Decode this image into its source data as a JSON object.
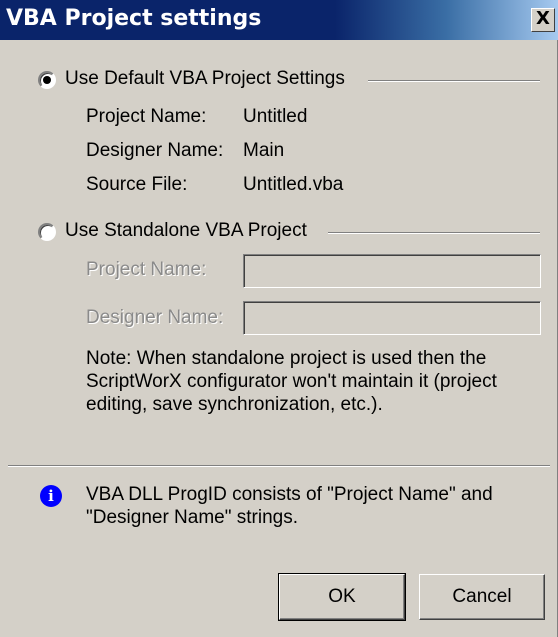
{
  "window": {
    "title": "VBA Project settings",
    "close_glyph": "X"
  },
  "default_option": {
    "label": "Use Default VBA Project Settings",
    "selected": true,
    "project_name_label": "Project Name:",
    "project_name_value": "Untitled",
    "designer_name_label": "Designer Name:",
    "designer_name_value": "Main",
    "source_file_label": "Source File:",
    "source_file_value": "Untitled.vba"
  },
  "standalone_option": {
    "label": "Use Standalone VBA Project",
    "selected": false,
    "project_name_label": "Project Name:",
    "project_name_value": "",
    "designer_name_label": "Designer Name:",
    "designer_name_value": "",
    "note_line1": "Note: When standalone project is used then the",
    "note_line2": "ScriptWorX configurator won't maintain it (project",
    "note_line3": "editing, save synchronization, etc.)."
  },
  "info": {
    "icon": "info-icon",
    "glyph": "i",
    "line1": "VBA DLL ProgID consists of \"Project Name\" and",
    "line2": "\"Designer Name\" strings."
  },
  "buttons": {
    "ok": "OK",
    "cancel": "Cancel"
  },
  "colors": {
    "titlebar": "#0a246a",
    "face": "#d4d0c8",
    "info_icon": "#0000ff"
  }
}
